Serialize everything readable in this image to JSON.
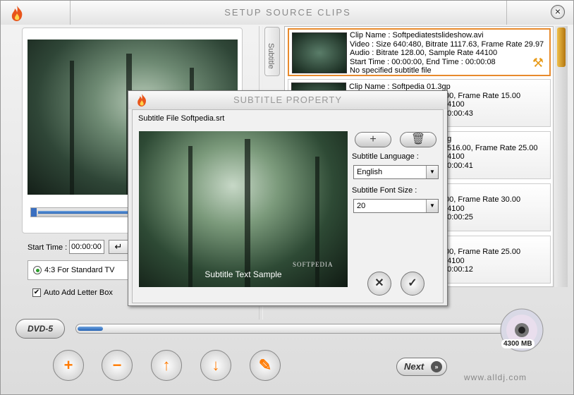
{
  "window": {
    "title": "SETUP SOURCE CLIPS",
    "close_icon": "×"
  },
  "preview": {
    "start_time_label": "Start Time :",
    "start_time_value": "00:00:00",
    "enter_glyph": "↵"
  },
  "aspect": {
    "option_label": "4:3 For Standard TV"
  },
  "letterbox": {
    "label": "Auto Add Letter Box",
    "checked": true
  },
  "subtitle_tab": {
    "label": "Subtitle"
  },
  "clips": [
    {
      "lines": [
        "Clip Name : Softpediatestslideshow.avi",
        "Video : Size 640:480, Bitrate 1117.63, Frame Rate 29.97",
        "Audio : Bitrate 128.00, Sample Rate 44100",
        "Start Time : 00:00:00, End Time : 00:00:08",
        "No specified subtitle file"
      ]
    },
    {
      "lines": [
        "Clip Name : Softpedia 01.3gp",
        ".00, Frame Rate 15.00",
        "44100",
        "00:00:43"
      ]
    },
    {
      "lines": [
        "eg",
        "2516.00, Frame Rate 25.00",
        "44100",
        "00:00:41"
      ]
    },
    {
      "lines": [
        ".00, Frame Rate 30.00",
        "44100",
        "00:00:25"
      ]
    },
    {
      "lines": [
        ".00, Frame Rate 25.00",
        "44100",
        "00:00:12"
      ]
    }
  ],
  "disc": {
    "type": "DVD-5",
    "capacity_label": "4300 MB",
    "used_fraction": 0.06
  },
  "toolbar": {
    "add": "+",
    "remove": "−",
    "up": "↑",
    "down": "↓",
    "settings": "✎"
  },
  "next_label": "Next",
  "footer_url": "www.alldj.com",
  "dialog": {
    "title": "SUBTITLE PROPERTY",
    "file_label": "Subtitle File Softpedia.srt",
    "sample_text": "Subtitle Text Sample",
    "brand_text": "SOFTPEDIA",
    "language_label": "Subtitle Language :",
    "language_value": "English",
    "font_size_label": "Subtitle Font Size :",
    "font_size_value": "20",
    "add_glyph": "+",
    "delete_glyph": "🗑",
    "cancel_glyph": "✕",
    "ok_glyph": "✓",
    "dropdown_glyph": "▼"
  },
  "colors": {
    "accent_orange": "#e88a2c",
    "progress_blue": "#2461b3"
  }
}
